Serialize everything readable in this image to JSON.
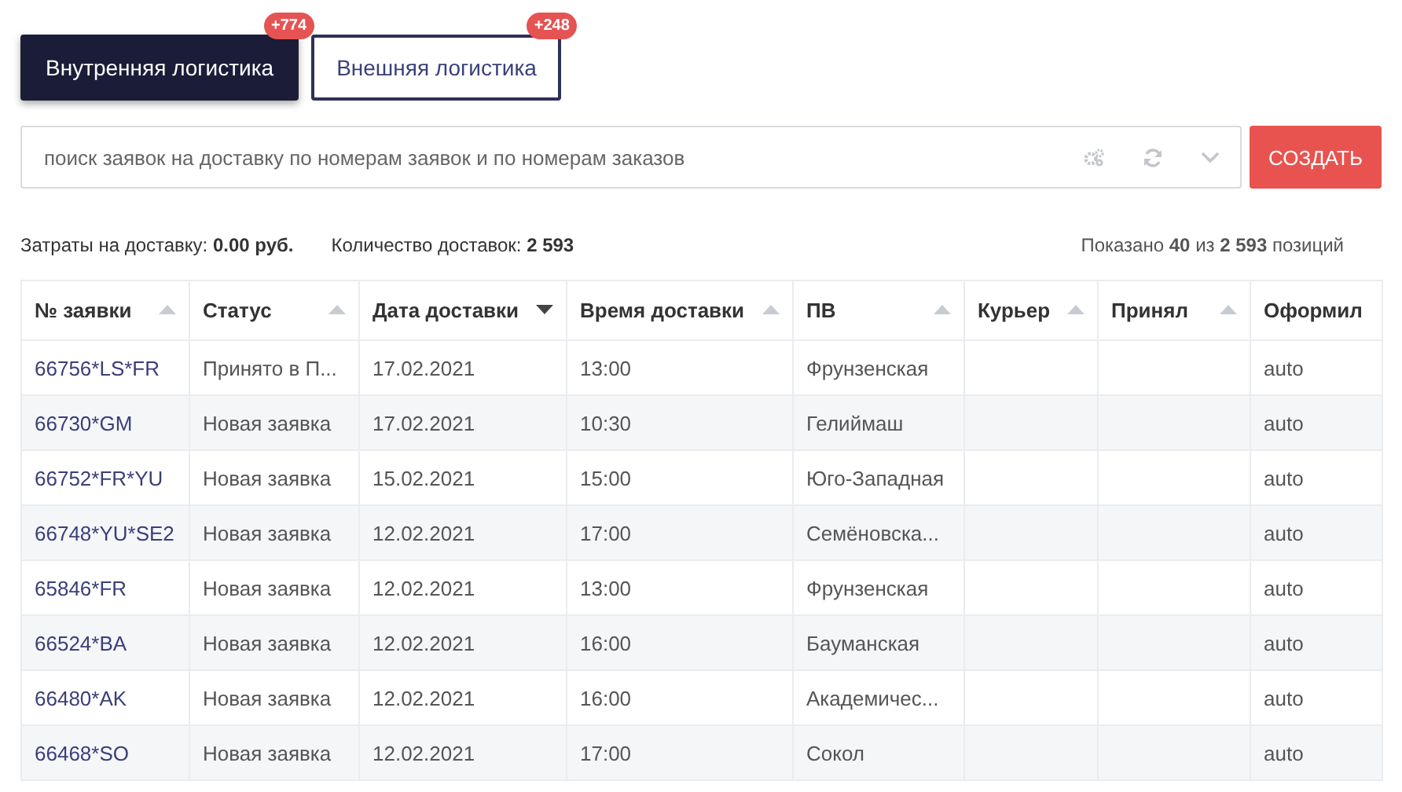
{
  "tabs": [
    {
      "label": "Внутренняя логистика",
      "selected": true,
      "badge": "+774"
    },
    {
      "label": "Внешняя логистика",
      "selected": false,
      "badge": "+248"
    }
  ],
  "search": {
    "placeholder": "поиск заявок на доставку по номерам заявок и по номерам заказов"
  },
  "create_button": "СОЗДАТЬ",
  "summary": {
    "cost": "Затраты на доставку: **0.00 руб.**",
    "count": "Количество доставок: **2 593**",
    "shown": "Показано **40** из **2 593** позиций"
  },
  "table": {
    "columns": [
      {
        "label": "№ заявки",
        "sortable": true,
        "sorted": false
      },
      {
        "label": "Статус",
        "sortable": true,
        "sorted": false
      },
      {
        "label": "Дата доставки",
        "sortable": true,
        "sorted": true
      },
      {
        "label": "Время доставки",
        "sortable": true,
        "sorted": false
      },
      {
        "label": "ПВ",
        "sortable": true,
        "sorted": false
      },
      {
        "label": "Курьер",
        "sortable": true,
        "sorted": false
      },
      {
        "label": "Принял",
        "sortable": true,
        "sorted": false
      },
      {
        "label": "Оформил",
        "sortable": false
      }
    ],
    "rows": [
      [
        "66756*LS*FR",
        "Принято в П...",
        "17.02.2021",
        "13:00",
        "Фрунзенская",
        "",
        "",
        "auto"
      ],
      [
        "66730*GM",
        "Новая заявка",
        "17.02.2021",
        "10:30",
        "Гелиймаш",
        "",
        "",
        "auto"
      ],
      [
        "66752*FR*YU",
        "Новая заявка",
        "15.02.2021",
        "15:00",
        "Юго-Западная",
        "",
        "",
        "auto"
      ],
      [
        "66748*YU*SE2",
        "Новая заявка",
        "12.02.2021",
        "17:00",
        "Семёновска...",
        "",
        "",
        "auto"
      ],
      [
        "65846*FR",
        "Новая заявка",
        "12.02.2021",
        "13:00",
        "Фрунзенская",
        "",
        "",
        "auto"
      ],
      [
        "66524*BA",
        "Новая заявка",
        "12.02.2021",
        "16:00",
        "Бауманская",
        "",
        "",
        "auto"
      ],
      [
        "66480*AK",
        "Новая заявка",
        "12.02.2021",
        "16:00",
        "Академичес...",
        "",
        "",
        "auto"
      ],
      [
        "66468*SO",
        "Новая заявка",
        "12.02.2021",
        "17:00",
        "Сокол",
        "",
        "",
        "auto"
      ]
    ]
  }
}
